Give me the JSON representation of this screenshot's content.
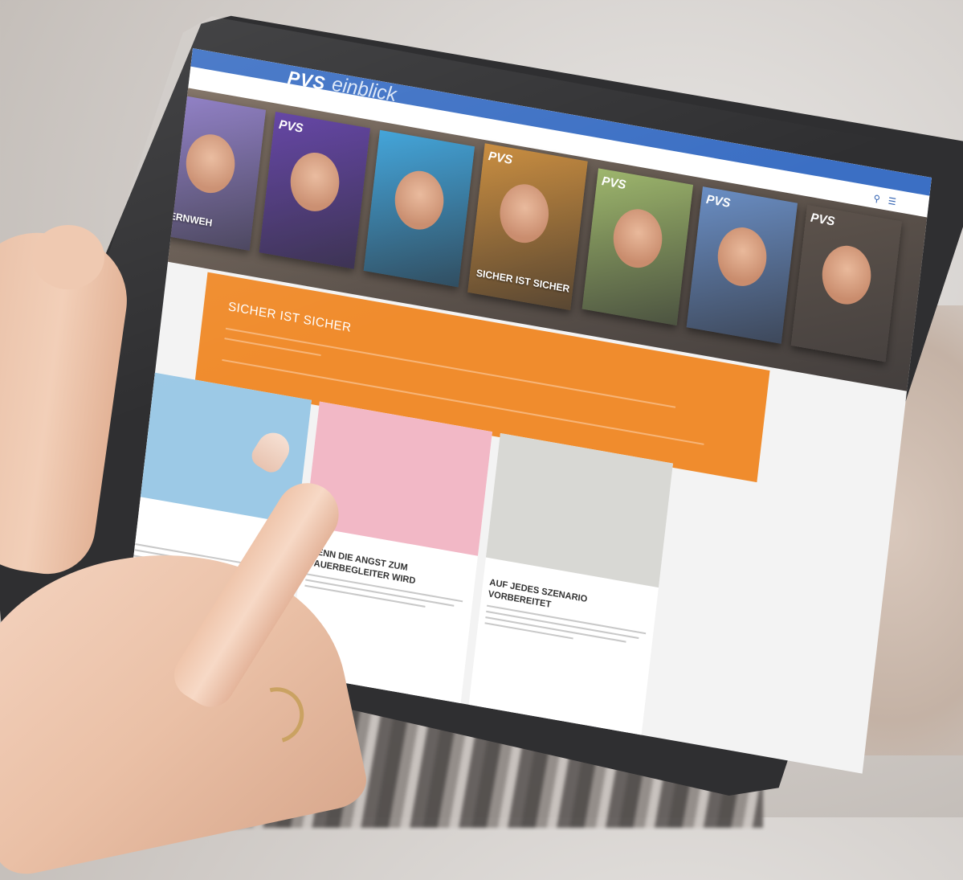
{
  "photo": {
    "scene": "",
    "device": "",
    "colors": {
      "brand_blue": "#3b6fc4",
      "accent_orange": "#f08c2d",
      "bezel": "#2f2f31",
      "cover_strip": "#555558"
    }
  },
  "site": {
    "logo_brand": "PVS",
    "logo_product": "einblick",
    "header_icons": [
      "search-icon",
      "menu-icon"
    ],
    "nav_items": [
      "",
      "",
      "",
      "",
      "",
      ""
    ]
  },
  "covers": [
    {
      "brand": "",
      "title": "FERNWEH",
      "bg": "#7a6a5c"
    },
    {
      "brand": "PVS",
      "title": "",
      "bg": "#8a78c4"
    },
    {
      "brand": "",
      "title": "",
      "bg": "#5b3aa0"
    },
    {
      "brand": "PVS",
      "title": "SICHER IST SICHER",
      "bg": "#3aa0d8"
    },
    {
      "brand": "PVS",
      "title": "",
      "bg": "#c88a3a"
    },
    {
      "brand": "PVS",
      "title": "",
      "bg": "#9cb56a"
    },
    {
      "brand": "PVS",
      "title": "",
      "bg": "#6a8ec4"
    }
  ],
  "hero": {
    "kicker": "",
    "title": "SICHER IST SICHER"
  },
  "articles": [
    {
      "category": "",
      "title": "",
      "img_bg": "#9cc9e6"
    },
    {
      "category": "",
      "title": "WENN DIE ANGST ZUM DAUERBEGLEITER WIRD",
      "img_bg": "#f2b8c6"
    },
    {
      "category": "",
      "title": "AUF JEDES SZENARIO VORBEREITET",
      "img_bg": "#d8d8d4"
    }
  ]
}
